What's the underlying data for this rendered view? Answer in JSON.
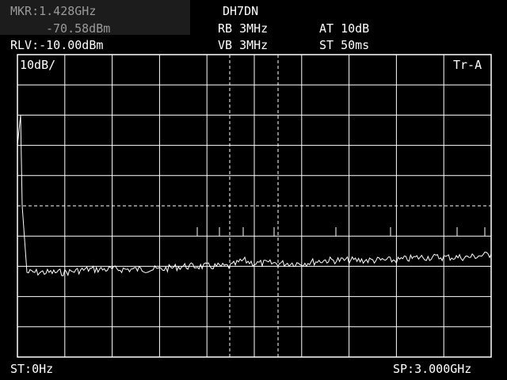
{
  "header": {
    "marker_freq": "MKR:1.428GHz",
    "marker_level": "-70.58dBm",
    "ref_level": "RLV:-10.00dBm",
    "callsign": "DH7DN",
    "rbw": "RB 3MHz",
    "vbw": "VB 3MHz",
    "attenuation": "AT 10dB",
    "sweep_time": "ST 50ms"
  },
  "plot": {
    "scale": "10dB/",
    "trace": "Tr-A"
  },
  "footer": {
    "start": "ST:0Hz",
    "stop": "SP:3.000GHz"
  },
  "colors": {
    "background": "#000000",
    "foreground": "#ffffff",
    "grid": "#ffffff",
    "marker_box": "#1c1c1c"
  },
  "chart_data": {
    "type": "line",
    "series": [
      {
        "x": [
          0.0,
          0.02,
          0.03,
          0.06,
          0.15,
          0.3,
          0.45,
          0.6,
          0.75,
          0.9,
          1.05,
          1.2,
          1.35,
          1.43,
          1.5,
          1.65,
          1.8,
          1.95,
          2.1,
          2.25,
          2.4,
          2.55,
          2.7,
          2.85,
          3.0
        ],
        "y": [
          -40,
          -30,
          -60,
          -82,
          -82,
          -82,
          -81,
          -81,
          -81,
          -81,
          -80,
          -80,
          -80,
          -78,
          -79,
          -79,
          -79,
          -78,
          -78,
          -78,
          -78,
          -77,
          -77,
          -77,
          -76
        ]
      }
    ],
    "xlim": [
      0,
      3.0
    ],
    "ylim": [
      -110,
      -10
    ],
    "grid": true
  }
}
